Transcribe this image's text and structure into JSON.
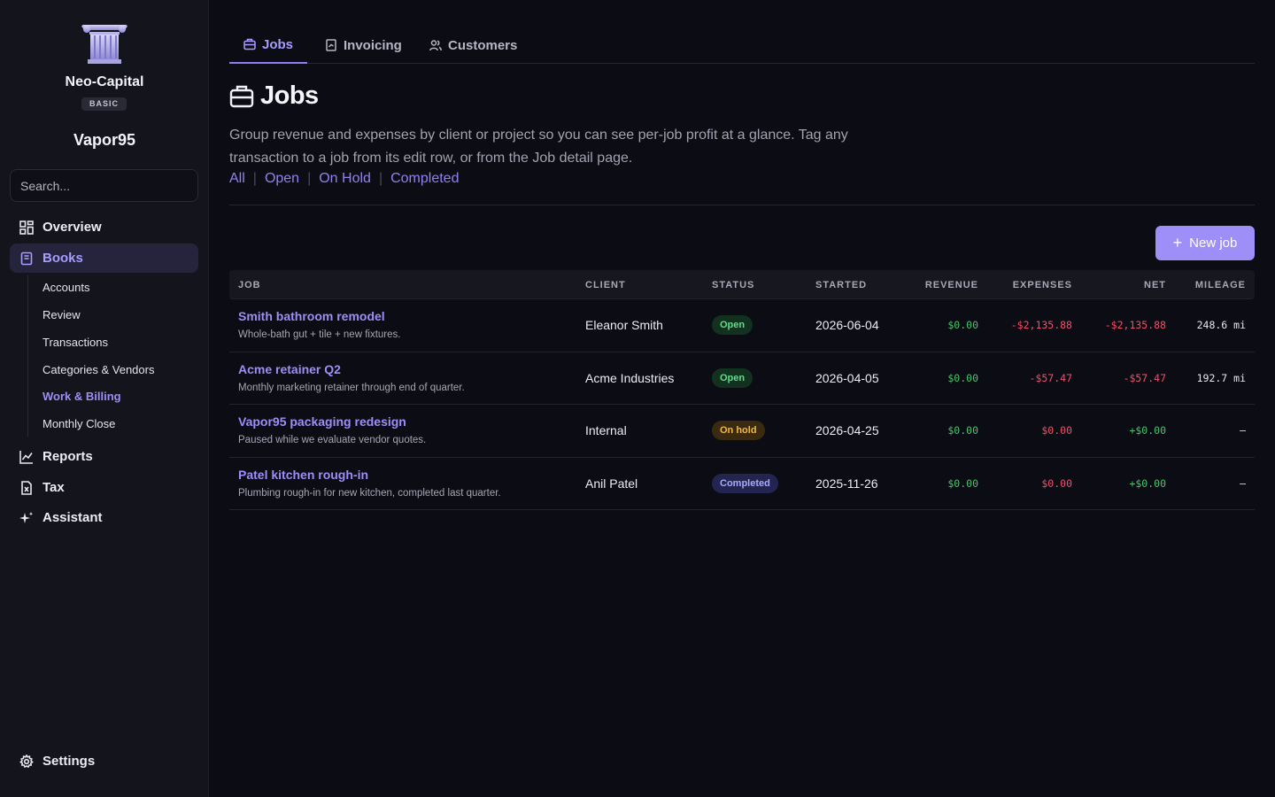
{
  "sidebar": {
    "brand": "Neo-Capital",
    "plan": "BASIC",
    "company": "Vapor95",
    "search_placeholder": "Search...",
    "nav": [
      {
        "label": "Overview",
        "icon": "overview-grid-icon"
      },
      {
        "label": "Books",
        "icon": "book-icon",
        "active": true
      },
      {
        "label": "Reports",
        "icon": "chart-icon"
      },
      {
        "label": "Tax",
        "icon": "tax-document-icon"
      },
      {
        "label": "Assistant",
        "icon": "sparkle-icon"
      }
    ],
    "books_sub": [
      "Accounts",
      "Review",
      "Transactions",
      "Categories & Vendors",
      "Work & Billing",
      "Monthly Close"
    ],
    "settings": "Settings"
  },
  "tabs": [
    "Jobs",
    "Invoicing",
    "Customers"
  ],
  "page": {
    "title": "Jobs",
    "description": "Group revenue and expenses by client or project so you can see per-job profit at a glance. Tag any transaction to a job from its edit row, or from the Job detail page.",
    "filters": [
      "All",
      "Open",
      "On Hold",
      "Completed"
    ],
    "new_button": "New job"
  },
  "table": {
    "headers": [
      "JOB",
      "CLIENT",
      "STATUS",
      "STARTED",
      "REVENUE",
      "EXPENSES",
      "NET",
      "MILEAGE"
    ],
    "rows": [
      {
        "name": "Smith bathroom remodel",
        "desc": "Whole-bath gut + tile + new fixtures.",
        "client": "Eleanor Smith",
        "status": "Open",
        "started": "2026-06-04",
        "revenue": "$0.00",
        "expenses": "-$2,135.88",
        "net": "-$2,135.88",
        "mileage": "248.6 mi"
      },
      {
        "name": "Acme retainer Q2",
        "desc": "Monthly marketing retainer through end of quarter.",
        "client": "Acme Industries",
        "status": "Open",
        "started": "2026-04-05",
        "revenue": "$0.00",
        "expenses": "-$57.47",
        "net": "-$57.47",
        "mileage": "192.7 mi"
      },
      {
        "name": "Vapor95 packaging redesign",
        "desc": "Paused while we evaluate vendor quotes.",
        "client": "Internal",
        "status": "On hold",
        "started": "2026-04-25",
        "revenue": "$0.00",
        "expenses": "$0.00",
        "net": "+$0.00",
        "mileage": "—"
      },
      {
        "name": "Patel kitchen rough-in",
        "desc": "Plumbing rough-in for new kitchen, completed last quarter.",
        "client": "Anil Patel",
        "status": "Completed",
        "started": "2025-11-26",
        "revenue": "$0.00",
        "expenses": "$0.00",
        "net": "+$0.00",
        "mileage": "—"
      }
    ]
  },
  "colors": {
    "accent": "#9e8ff8",
    "positive": "#4cc46e",
    "negative": "#f0506a",
    "background": "#0c0c14",
    "sidebar": "#14141d"
  }
}
